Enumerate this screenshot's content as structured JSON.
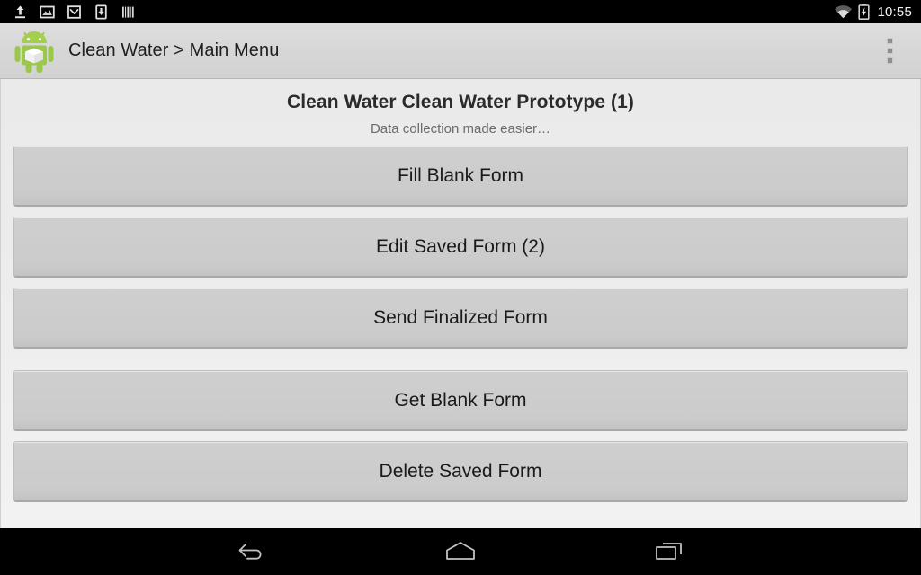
{
  "status_bar": {
    "notification_icons": [
      {
        "name": "upload-icon",
        "label": "upload"
      },
      {
        "name": "photo-icon",
        "label": "photo"
      },
      {
        "name": "email-icon",
        "label": "email"
      },
      {
        "name": "download-icon",
        "label": "download"
      },
      {
        "name": "barcode-icon",
        "label": "barcode"
      }
    ],
    "wifi_icon": "wifi-icon",
    "battery_icon": "battery-charging-icon",
    "time": "10:55"
  },
  "app_bar": {
    "app_icon": "odk-android-robot-icon",
    "title": "Clean Water > Main Menu",
    "overflow_icon": "overflow-menu-icon"
  },
  "main": {
    "title": "Clean Water Clean Water Prototype (1)",
    "subtitle": "Data collection made easier…",
    "primary_buttons": [
      {
        "id": "fill-blank-form",
        "label": "Fill Blank Form"
      },
      {
        "id": "edit-saved-form",
        "label": "Edit Saved Form (2)"
      },
      {
        "id": "send-finalized-form",
        "label": "Send Finalized Form"
      }
    ],
    "secondary_buttons": [
      {
        "id": "get-blank-form",
        "label": "Get Blank Form"
      },
      {
        "id": "delete-saved-form",
        "label": "Delete Saved Form"
      }
    ]
  },
  "nav_bar": {
    "back_icon": "back-arrow-icon",
    "home_icon": "home-icon",
    "recents_icon": "recent-apps-icon"
  },
  "colors": {
    "status_bar_bg": "#000000",
    "app_bar_bg": "#d6d6d6",
    "content_bg": "#ededed",
    "button_bg": "#cbcbcb",
    "text_primary": "#1a1a1a",
    "text_secondary": "#6b6b6b",
    "robot_green": "#8fc546"
  }
}
